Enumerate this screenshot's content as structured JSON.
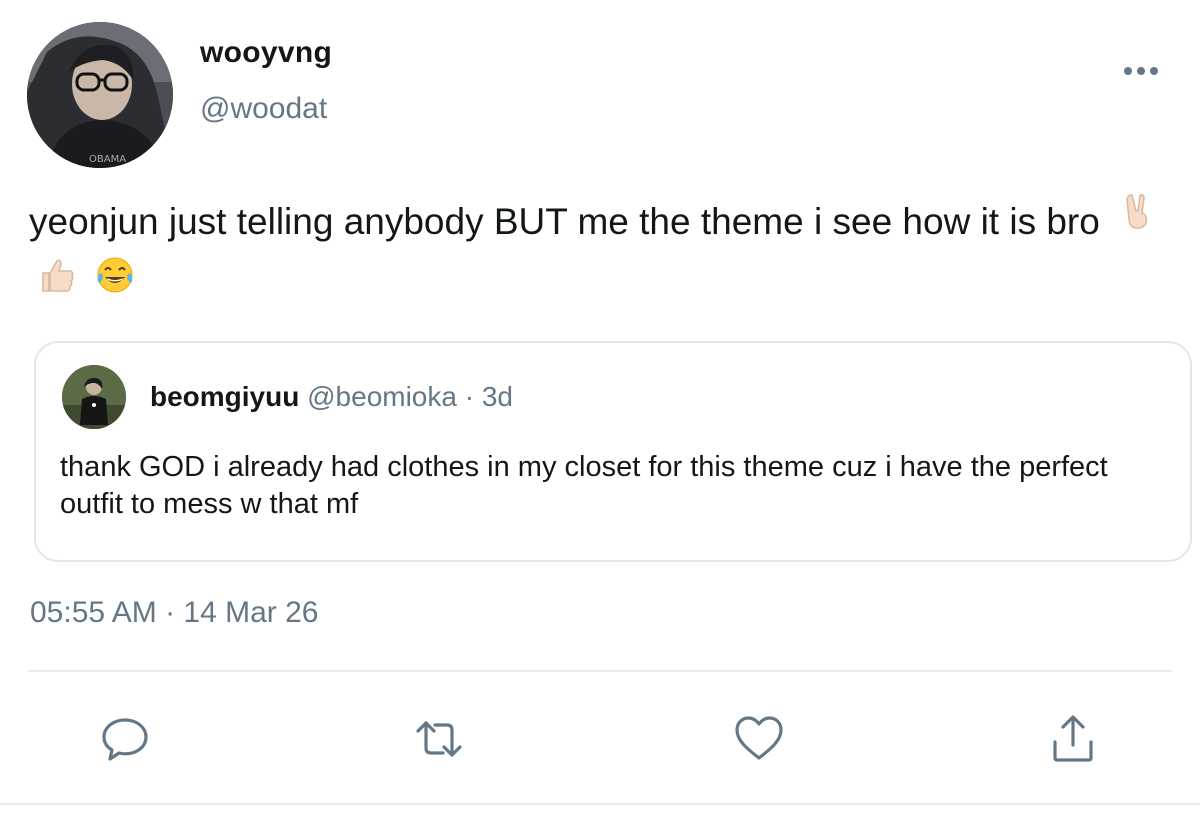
{
  "tweet": {
    "author": {
      "display_name": "wooyvng",
      "handle": "@woodat"
    },
    "text": "yeonjun just telling anybody BUT me the theme i see how it is bro",
    "emojis": [
      "victory-hand-emoji",
      "thumbs-up-emoji",
      "tears-of-joy-emoji"
    ],
    "timestamp": "05:55 AM · 14 Mar 26"
  },
  "quote": {
    "display_name": "beomgiyuu",
    "handle_time": "@beomioka · 3d",
    "text": "thank GOD i already had clothes in my closet for this theme cuz i have the perfect outfit to mess w that mf"
  },
  "actions": {
    "icons": [
      "reply-icon",
      "retweet-icon",
      "like-icon",
      "share-icon"
    ]
  },
  "colors": {
    "text_primary": "#14171a",
    "text_secondary": "#657786",
    "icon_gray": "#657786",
    "border": "#e1e8ed"
  }
}
